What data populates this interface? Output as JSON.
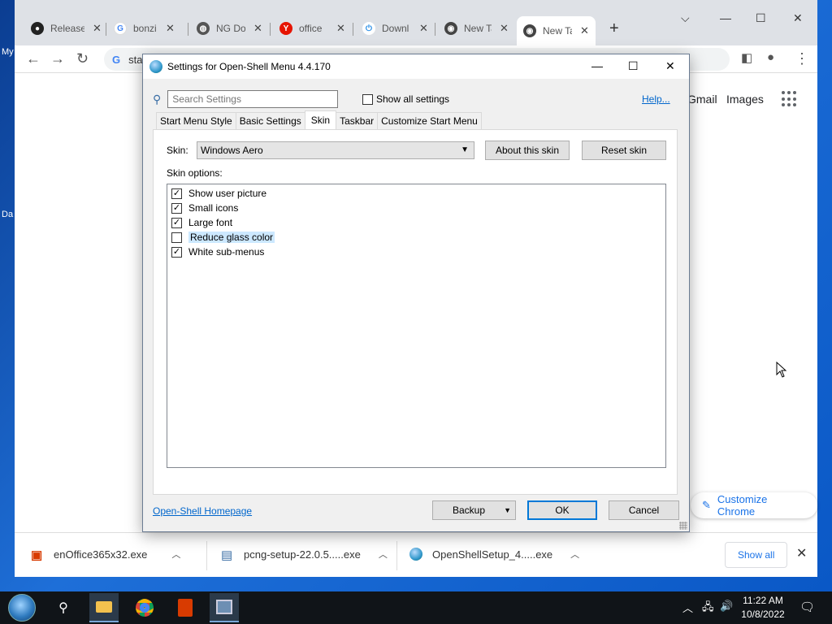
{
  "desktop": {
    "labels": [
      "My",
      "Da"
    ]
  },
  "browser": {
    "tabs": [
      {
        "title": "Release",
        "icon": "github-icon"
      },
      {
        "title": "bonzi",
        "icon": "google-icon"
      },
      {
        "title": "NG Do",
        "icon": "globe-icon"
      },
      {
        "title": "office",
        "icon": "yandex-icon"
      },
      {
        "title": "Downl",
        "icon": "power-icon"
      },
      {
        "title": "New Ta",
        "icon": "chrome-icon"
      },
      {
        "title": "New Ta",
        "icon": "chrome-icon"
      }
    ],
    "omnibox_text": "sta",
    "header_links": {
      "gmail": "Gmail",
      "images": "Images"
    },
    "customize_label": "Customize Chrome"
  },
  "dialog": {
    "title": "Settings for Open-Shell Menu 4.4.170",
    "search_placeholder": "Search Settings",
    "show_all_label": "Show all settings",
    "help_label": "Help...",
    "tabs": [
      {
        "label": "Start Menu Style",
        "selected": false
      },
      {
        "label": "Basic Settings",
        "selected": false
      },
      {
        "label": "Skin",
        "selected": true
      },
      {
        "label": "Taskbar",
        "selected": false
      },
      {
        "label": "Customize Start Menu",
        "selected": false
      }
    ],
    "skin_label": "Skin:",
    "skin_value": "Windows Aero",
    "about_skin_label": "About this skin",
    "reset_skin_label": "Reset skin",
    "skin_options_label": "Skin options:",
    "options": [
      {
        "label": "Show user picture",
        "checked": true
      },
      {
        "label": "Small icons",
        "checked": true
      },
      {
        "label": "Large font",
        "checked": true
      },
      {
        "label": "Reduce glass color",
        "checked": false
      },
      {
        "label": "White sub-menus",
        "checked": true
      }
    ],
    "homepage_label": "Open-Shell Homepage",
    "backup_label": "Backup",
    "ok_label": "OK",
    "cancel_label": "Cancel"
  },
  "downloads": {
    "items": [
      {
        "name": "enOffice365x32.exe",
        "icon": "office-icon"
      },
      {
        "name": "pcng-setup-22.0.5.....exe",
        "icon": "installer-icon"
      },
      {
        "name": "OpenShellSetup_4.....exe",
        "icon": "openshell-icon"
      }
    ],
    "show_all_label": "Show all"
  },
  "taskbar": {
    "time": "11:22 AM",
    "date": "10/8/2022"
  },
  "colors": {
    "accent": "#0078d7",
    "link": "#0066cc",
    "chrome_blue": "#1a73e8"
  }
}
